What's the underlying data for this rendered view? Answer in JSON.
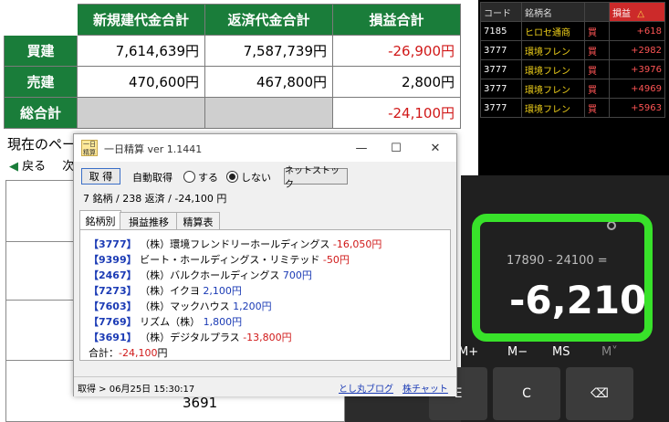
{
  "summary": {
    "col_headers": [
      "新規建代金合計",
      "返済代金合計",
      "損益合計"
    ],
    "rows": [
      {
        "label": "買建",
        "new_total": "7,614,639円",
        "close_total": "7,587,739円",
        "pl": "-26,900円"
      },
      {
        "label": "売建",
        "new_total": "470,600円",
        "close_total": "467,800円",
        "pl": "2,800円"
      },
      {
        "label": "総合計",
        "new_total": "",
        "close_total": "",
        "pl": "-24,100円"
      }
    ]
  },
  "page": {
    "current_label": "現在のペー",
    "back_label": "戻る",
    "next_label": "次",
    "bottom_code": "3691"
  },
  "ticker": {
    "headers": [
      "コード",
      "銘柄名",
      "",
      "損益"
    ],
    "sort_mark": "△",
    "rows": [
      {
        "code": "7185",
        "name": "ヒロセ通商",
        "side": "買",
        "pl": "+618"
      },
      {
        "code": "3777",
        "name": "環境フレン",
        "side": "買",
        "pl": "+2982"
      },
      {
        "code": "3777",
        "name": "環境フレン",
        "side": "買",
        "pl": "+3976"
      },
      {
        "code": "3777",
        "name": "環境フレン",
        "side": "買",
        "pl": "+4969"
      },
      {
        "code": "3777",
        "name": "環境フレン",
        "side": "買",
        "pl": "+5963"
      }
    ]
  },
  "calculator": {
    "expression": "17890 - 24100 =",
    "result": "-6,210",
    "memory_keys": [
      "M+",
      "M−",
      "MS",
      "M˅"
    ],
    "keys": [
      "E",
      "C",
      "⌫"
    ]
  },
  "window": {
    "title": "一日精算 ver 1.1441",
    "icon_text": "一日\n精算",
    "controls": {
      "minimize": "—",
      "maximize": "☐",
      "close": "✕"
    },
    "fetch_button": "取 得",
    "auto_fetch_label": "自動取得",
    "radio_on_label": "する",
    "radio_off_label": "しない",
    "netstock_button": "ネットストック",
    "summary_line": "7 銘柄 / 238 返済 / -24,100 円",
    "tabs": [
      "銘柄別",
      "損益推移",
      "精算表"
    ],
    "items": [
      {
        "code": "【3777】",
        "name": "（株）環境フレンドリーホールディングス",
        "pl": "-16,050円",
        "sign": "neg"
      },
      {
        "code": "【9399】",
        "name": "ビート・ホールディングス・リミテッド",
        "pl": "-50円",
        "sign": "neg"
      },
      {
        "code": "【2467】",
        "name": "（株）バルクホールディングス",
        "pl": "700円",
        "sign": "pos"
      },
      {
        "code": "【7273】",
        "name": "（株）イクヨ",
        "pl": "2,100円",
        "sign": "pos"
      },
      {
        "code": "【7603】",
        "name": "（株）マックハウス",
        "pl": "1,200円",
        "sign": "pos"
      },
      {
        "code": "【7769】",
        "name": "リズム（株）",
        "pl": "1,800円",
        "sign": "pos"
      },
      {
        "code": "【3691】",
        "name": "（株）デジタルプラス",
        "pl": "-13,800円",
        "sign": "neg"
      }
    ],
    "total_label": "合計：",
    "total_value": "-24,100",
    "total_unit": "円",
    "status_text": "取得 > 06月25日 15:30:17",
    "link_blog": "とし丸ブログ",
    "link_chart": "株チャット"
  },
  "colors": {
    "green": "#1a7d3a",
    "negative": "#d01818",
    "positive": "#1b3bb5",
    "highlight": "#38e22a"
  }
}
